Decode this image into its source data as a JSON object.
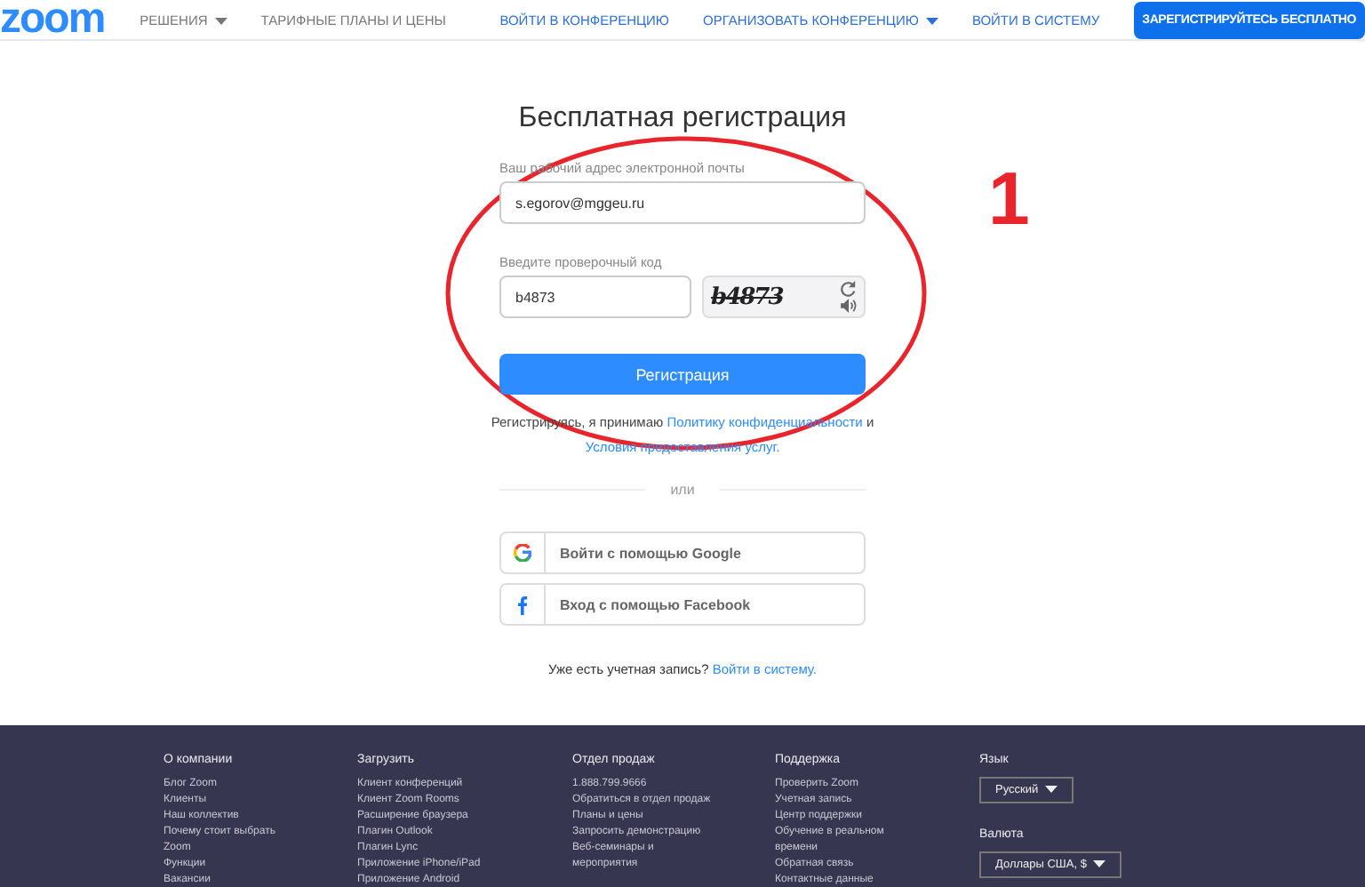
{
  "header": {
    "logo": "zoom",
    "nav": [
      {
        "label": "РЕШЕНИЯ",
        "dropdown": true
      },
      {
        "label": "ТАРИФНЫЕ ПЛАНЫ И ЦЕНЫ",
        "dropdown": false
      }
    ],
    "right_nav": [
      {
        "label": "ВОЙТИ В КОНФЕРЕНЦИЮ",
        "dropdown": false
      },
      {
        "label": "ОРГАНИЗОВАТЬ КОНФЕРЕНЦИЮ",
        "dropdown": true
      },
      {
        "label": "ВОЙТИ В СИСТЕМУ",
        "dropdown": false
      }
    ],
    "signup_button": "ЗАРЕГИСТРИРУЙТЕСЬ БЕСПЛАТНО"
  },
  "form": {
    "title": "Бесплатная регистрация",
    "email": {
      "label": "Ваш рабочий адрес электронной почты",
      "value": "s.egorov@mggeu.ru"
    },
    "code": {
      "label": "Введите проверочный код",
      "value": "b4873"
    },
    "captcha": "b4873",
    "submit": "Регистрация",
    "terms": [
      {
        "text": "Регистрируясь, я принимаю",
        "link": false
      },
      {
        "text": "Политику конфиденциальности",
        "link": true
      },
      {
        "text": "и",
        "link": false
      },
      {
        "text": "Условия предоставления услуг.",
        "link": true
      }
    ],
    "divider": "или",
    "social": [
      {
        "kind": "google",
        "label": "Войти с помощью Google"
      },
      {
        "kind": "facebook",
        "label": "Вход с помощью Facebook"
      }
    ],
    "login_prompt": "Уже есть учетная запись?",
    "login_link": "Войти в систему."
  },
  "footer": {
    "columns": [
      {
        "title": "О компании",
        "links": [
          "Блог Zoom",
          "Клиенты",
          "Наш коллектив",
          "Почему стоит выбрать",
          "Zoom",
          "Функции",
          "Вакансии"
        ]
      },
      {
        "title": "Загрузить",
        "links": [
          "Клиент конференций",
          "Клиент Zoom Rooms",
          "Расширение браузера",
          "Плагин Outlook",
          "Плагин Lync",
          "Приложение iPhone/iPad",
          "Приложение Android"
        ]
      },
      {
        "title": "Отдел продаж",
        "links": [
          "1.888.799.9666",
          "Обратиться в отдел продаж",
          "Планы и цены",
          "Запросить демонстрацию",
          "Веб-семинары и",
          "мероприятия"
        ]
      },
      {
        "title": "Поддержка",
        "links": [
          "Проверить Zoom",
          "Учетная запись",
          "Центр поддержки",
          "Обучение в реальном",
          "времени",
          "Обратная связь",
          "Контактные данные"
        ]
      }
    ],
    "language": {
      "label": "Язык",
      "value": "Русский"
    },
    "currency": {
      "label": "Валюта",
      "value": "Доллары США, $"
    }
  },
  "annotation": {
    "number": "1"
  }
}
